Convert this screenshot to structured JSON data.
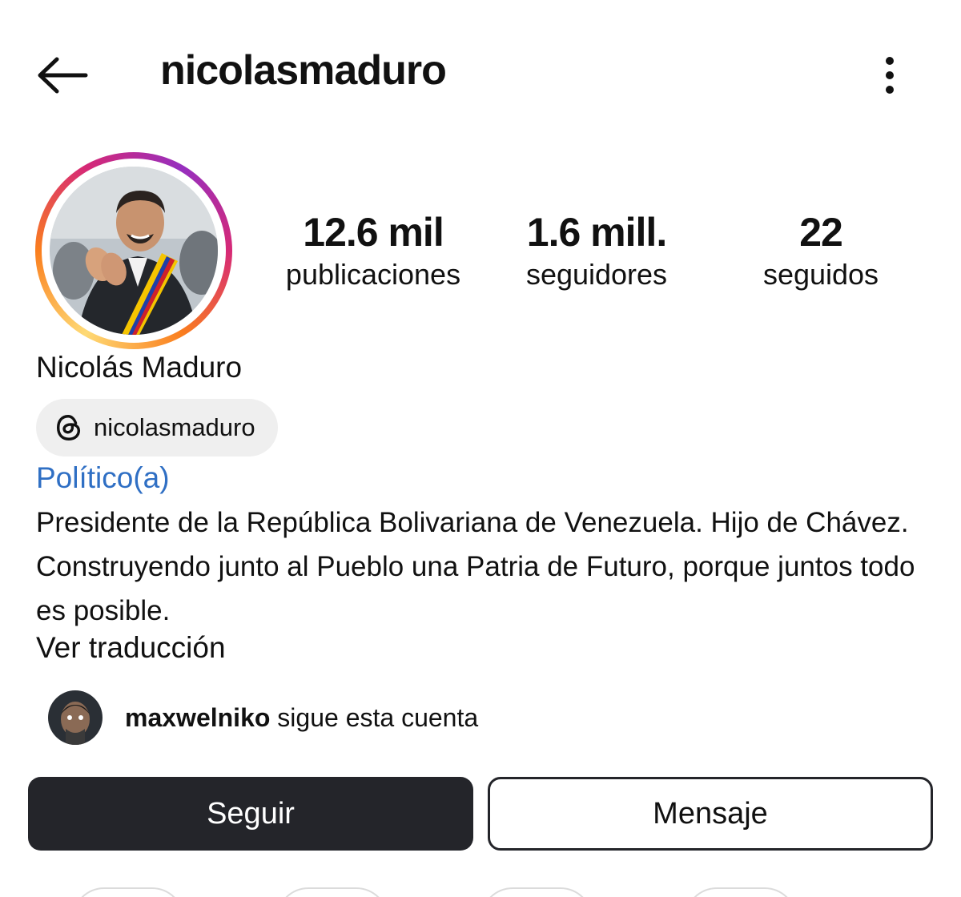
{
  "header": {
    "username": "nicolasmaduro"
  },
  "stats": {
    "posts_count": "12.6 mil",
    "posts_label": "publicaciones",
    "followers_count": "1.6 mill.",
    "followers_label": "seguidores",
    "following_count": "22",
    "following_label": "seguidos"
  },
  "profile": {
    "full_name": "Nicolás Maduro",
    "threads_handle": "nicolasmaduro",
    "category": "Político(a)",
    "bio": "Presidente de la República Bolivariana de Venezuela. Hijo de Chávez. Construyendo junto al Pueblo una Patria de Futuro, porque juntos todo es posible.",
    "translate_label": "Ver traducción"
  },
  "followed_by": {
    "username": "maxwelniko",
    "suffix": " sigue esta cuenta"
  },
  "actions": {
    "follow_label": "Seguir",
    "message_label": "Mensaje"
  },
  "colors": {
    "category_link": "#2f6fc4",
    "follow_button_bg": "#24252a",
    "story_ring": [
      "#feda75",
      "#fa7e1e",
      "#d62976",
      "#962fbf"
    ]
  },
  "icons": {
    "back": "arrow-left-icon",
    "more": "more-vertical-icon",
    "threads": "threads-icon"
  }
}
